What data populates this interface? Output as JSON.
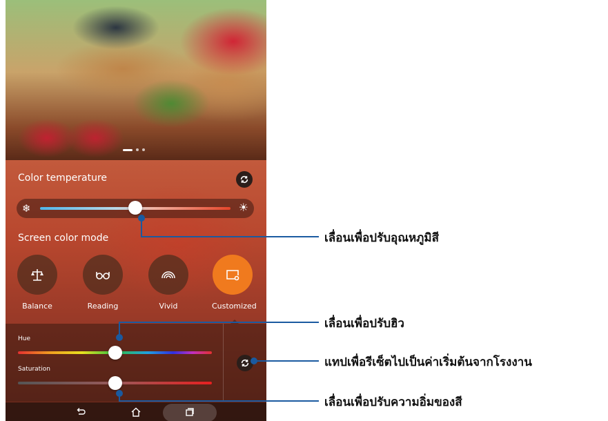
{
  "color_temperature": {
    "title": "Color temperature",
    "level": 0.5
  },
  "screen_color_mode": {
    "title": "Screen color mode",
    "modes": [
      {
        "label": "Balance",
        "icon": "scale-icon"
      },
      {
        "label": "Reading",
        "icon": "glasses-icon"
      },
      {
        "label": "Vivid",
        "icon": "rainbow-icon"
      },
      {
        "label": "Customized",
        "icon": "customize-icon",
        "selected": true
      }
    ]
  },
  "custom": {
    "hue_label": "Hue",
    "hue_level": 0.5,
    "saturation_label": "Saturation",
    "saturation_level": 0.5
  },
  "callouts": {
    "temperature": "เลื่อนเพื่อปรับอุณหภูมิสี",
    "hue": "เลื่อนเพื่อปรับฮิว",
    "reset": "แทปเพื่อรีเซ็ตไปเป็นค่าเริ่มต้นจากโรงงาน",
    "saturation": "เลื่อนเพื่อปรับความอิ่มของสี"
  },
  "colors": {
    "accent": "#f07a1e",
    "callout_line": "#1a5aa0"
  }
}
